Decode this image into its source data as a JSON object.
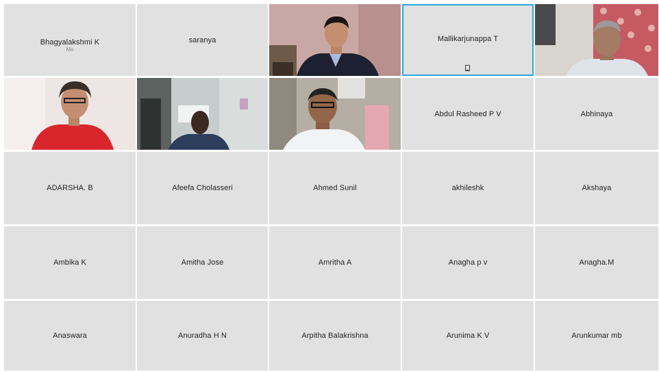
{
  "participants": [
    {
      "name": "Bhagyalakshmi K",
      "sub": "Me"
    },
    {
      "name": "saranya"
    },
    {
      "video": "person-in-suit"
    },
    {
      "name": "Mallikarjunappa T",
      "active": true
    },
    {
      "video": "older-man"
    },
    {
      "video": "woman-red"
    },
    {
      "video": "man-room"
    },
    {
      "video": "man-office"
    },
    {
      "name": "Abdul Rasheed P V"
    },
    {
      "name": "Abhinaya"
    },
    {
      "name": "ADARSHA. B"
    },
    {
      "name": "Afeefa Cholasseri"
    },
    {
      "name": "Ahmed Sunil"
    },
    {
      "name": "akhileshk"
    },
    {
      "name": "Akshaya"
    },
    {
      "name": "Ambika K"
    },
    {
      "name": "Amitha Jose"
    },
    {
      "name": "Amritha A"
    },
    {
      "name": "Anagha p v"
    },
    {
      "name": "Anagha.M"
    },
    {
      "name": "Anaswara"
    },
    {
      "name": "Anuradha H N"
    },
    {
      "name": "Arpitha Balakrishna"
    },
    {
      "name": "Arunima K V"
    },
    {
      "name": "Arunkumar mb"
    }
  ],
  "icons": {
    "active_tile_icon": "mobile-device-icon"
  },
  "colors": {
    "tile_bg": "#e1e1e1",
    "active_border": "#2aa7e0"
  }
}
